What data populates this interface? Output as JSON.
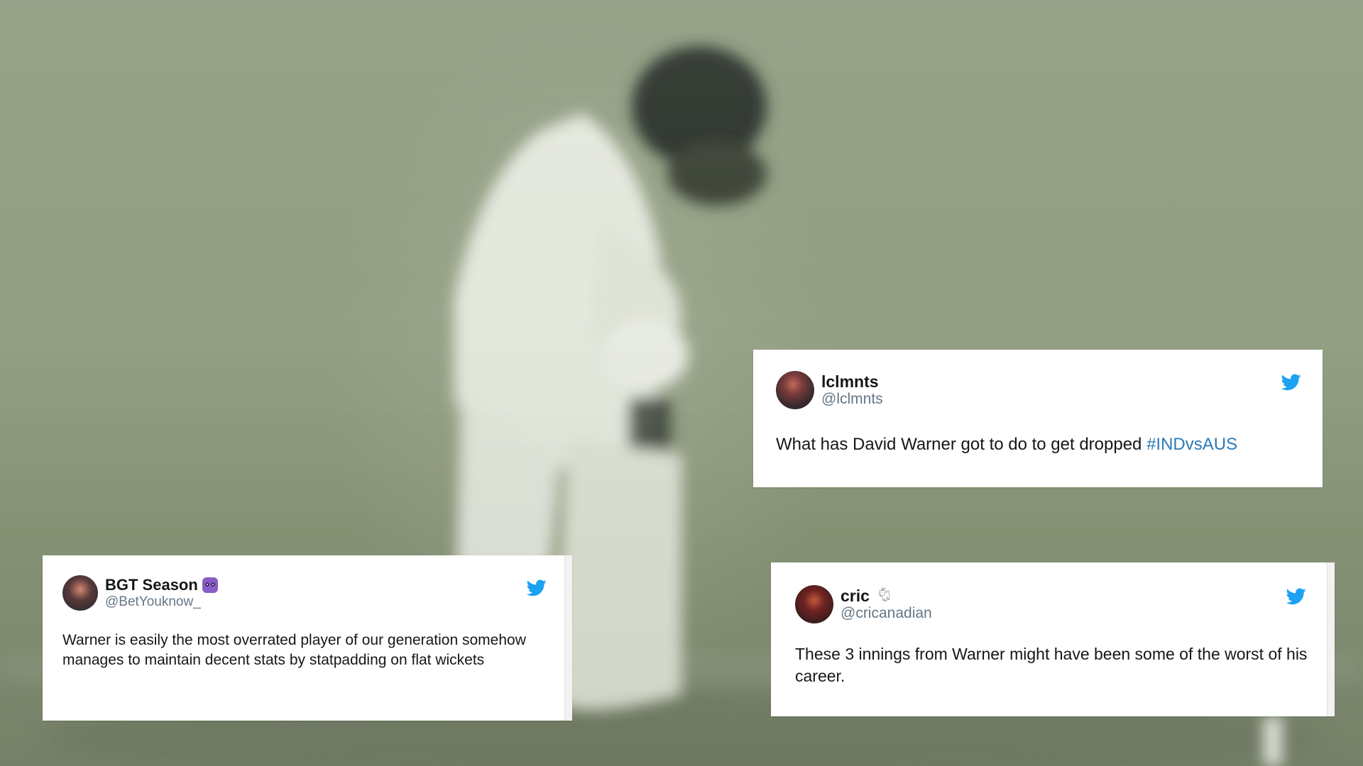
{
  "background": {
    "scene": "blurred-cricket-batsman",
    "palette": {
      "field": "#8f9c80",
      "kit": "#e6eae0"
    }
  },
  "tweets": [
    {
      "display_name": "lclmnts",
      "handle": "@lclmnts",
      "emoji": "",
      "text": "What has David Warner got to do to get dropped ",
      "hashtag": "#INDvsAUS",
      "icon": "twitter-bird-icon"
    },
    {
      "display_name": "BGT Season",
      "handle": "@BetYouknow_",
      "emoji": "owl-emoji",
      "text": "Warner is easily the most overrated player of our generation somehow manages to maintain decent stats by statpadding on flat wickets",
      "icon": "twitter-bird-icon"
    },
    {
      "display_name": "cric",
      "handle": "@cricanadian",
      "emoji": "goat-emoji",
      "text": "These 3 innings from Warner might have been some of the worst of his career.",
      "icon": "twitter-bird-icon"
    }
  ],
  "colors": {
    "twitter_blue": "#1da1f2",
    "hashtag": "#2b7bb9",
    "name": "#14171a",
    "handle": "#657786"
  }
}
